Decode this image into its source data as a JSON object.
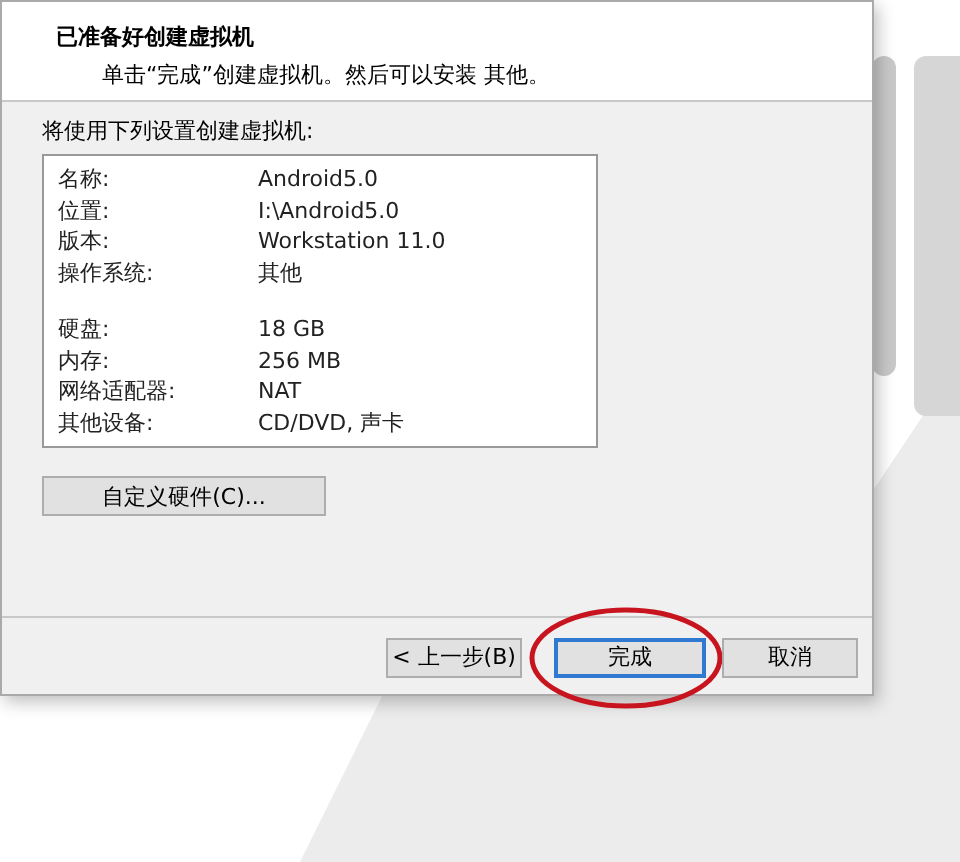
{
  "header": {
    "title": "已准备好创建虚拟机",
    "subtitle": "单击“完成”创建虚拟机。然后可以安装 其他。"
  },
  "intro": "将使用下列设置创建虚拟机:",
  "settings_groups": [
    [
      {
        "label": "名称:",
        "value": "Android5.0"
      },
      {
        "label": "位置:",
        "value": "I:\\Android5.0"
      },
      {
        "label": "版本:",
        "value": "Workstation 11.0"
      },
      {
        "label": "操作系统:",
        "value": "其他"
      }
    ],
    [
      {
        "label": "硬盘:",
        "value": "18 GB"
      },
      {
        "label": "内存:",
        "value": "256 MB"
      },
      {
        "label": "网络适配器:",
        "value": "NAT"
      },
      {
        "label": "其他设备:",
        "value": "CD/DVD, 声卡"
      }
    ]
  ],
  "customize_button": "自定义硬件(C)...",
  "buttons": [
    {
      "label": "< 上一步(B)",
      "default": false,
      "circled": false
    },
    {
      "label": "完成",
      "default": true,
      "circled": true
    },
    {
      "label": "取消",
      "default": false,
      "circled": false
    }
  ]
}
